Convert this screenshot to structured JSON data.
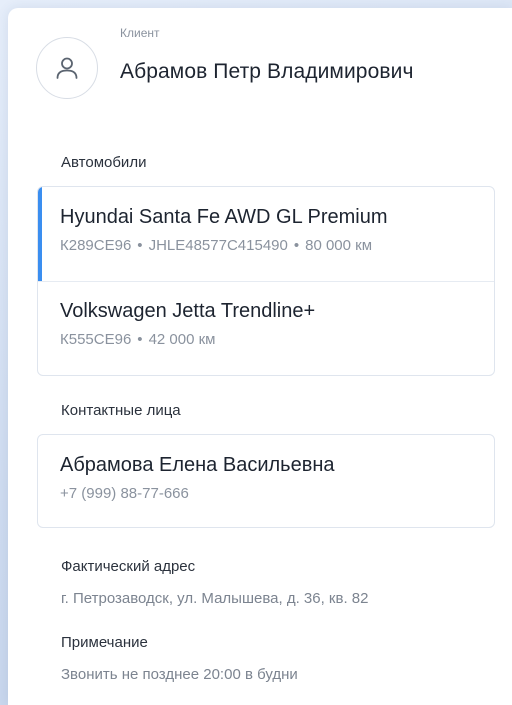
{
  "client": {
    "label": "Клиент",
    "name": "Абрамов Петр Владимирович",
    "avatar_icon": "user-icon"
  },
  "cars": {
    "label": "Автомобили",
    "items": [
      {
        "title": "Hyundai Santa Fe AWD GL Premium",
        "plate": "К289СЕ96",
        "vin": "JHLE48577C415490",
        "mileage": "80 000 км",
        "selected": true
      },
      {
        "title": "Volkswagen Jetta Trendline+",
        "plate": "К555СЕ96",
        "mileage": "42 000 км",
        "selected": false
      }
    ]
  },
  "contacts": {
    "label": "Контактные лица",
    "items": [
      {
        "name": "Абрамова Елена Васильевна",
        "phone": "+7 (999) 88-77-666"
      }
    ]
  },
  "address": {
    "label": "Фактический адрес",
    "value": "г. Петрозаводск, ул. Малышева, д. 36, кв. 82"
  },
  "note": {
    "label": "Примечание",
    "value": "Звонить не позднее 20:00 в будни"
  },
  "colors": {
    "accent": "#3a8ef0",
    "border": "#dfe5ee",
    "text": "#1d2430",
    "muted": "#8a929e"
  },
  "separator": "•"
}
